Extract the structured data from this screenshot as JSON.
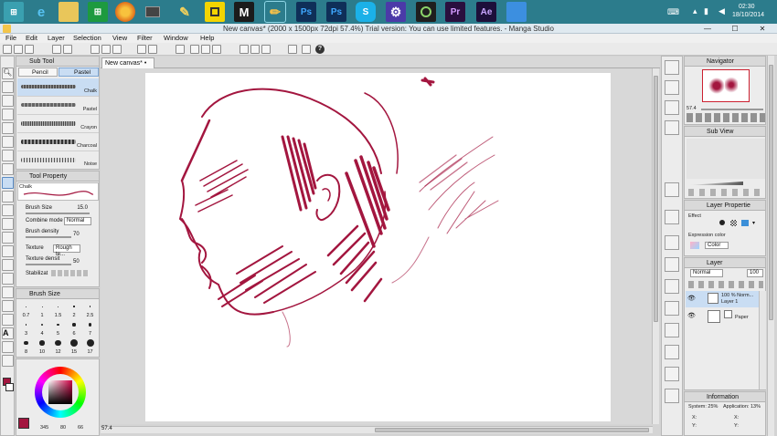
{
  "taskbar": {
    "icons": [
      "windows-store",
      "internet-explorer",
      "file-explorer",
      "store-bag",
      "firefox",
      "tablet",
      "pencil-app",
      "sketch-app",
      "manga-studio",
      "brush",
      "photoshop",
      "photoshop-2",
      "skype",
      "gear",
      "media",
      "premiere",
      "after-effects",
      "blank-app"
    ],
    "icon_labels": [
      "Pr",
      "Ae",
      "Ps",
      "Ps",
      "S",
      "M"
    ],
    "clock_time": "02:30",
    "clock_date": "18/10/2014"
  },
  "window": {
    "title": "New canvas* (2000 x 1500px 72dpi 57.4%)  Trial version: You can use limited features. - Manga Studio",
    "minimize": "—",
    "maximize": "☐",
    "close": "✕"
  },
  "menu": [
    "File",
    "Edit",
    "Layer",
    "Selection",
    "View",
    "Filter",
    "Window",
    "Help"
  ],
  "left_panel": {
    "sub_tool_title": "Sub Tool",
    "tabs": [
      "Pencil",
      "Pastel"
    ],
    "brushes": [
      "Chalk",
      "Pastel",
      "Crayon",
      "Charcoal",
      "Noise"
    ],
    "tool_property_title": "Tool Property",
    "tool_name": "Chalk",
    "props": {
      "brush_size_label": "Brush Size",
      "brush_size_value": "15.0",
      "combine_mode_label": "Combine mode",
      "combine_mode_value": "Normal",
      "brush_density_label": "Brush density",
      "brush_density_value": "70",
      "texture_label": "Texture",
      "texture_value": "Rough te...",
      "texture_density_label": "Texture densit",
      "texture_density_value": "50",
      "stabilization_label": "Stabilizat"
    },
    "brush_size_title": "Brush Size",
    "brush_size_presets": [
      "0.7",
      "1",
      "1.5",
      "2",
      "2.5",
      "3",
      "4",
      "5",
      "6",
      "7",
      "8",
      "10",
      "12",
      "15",
      "17"
    ],
    "color_values": [
      "345",
      "80",
      "66"
    ]
  },
  "canvas": {
    "tab_label": "New canvas*",
    "zoom_readout": "57.4"
  },
  "right_panel": {
    "navigator_title": "Navigator",
    "navigator_zoom": "57.4",
    "sub_view_title": "Sub View",
    "layer_property_title": "Layer Propertie",
    "effect_label": "Effect",
    "expression_color_label": "Expression color",
    "expression_color_value": "Color",
    "layer_title": "Layer",
    "blend_mode": "Normal",
    "opacity": "100",
    "layers": [
      {
        "name": "100 % Norm...",
        "sub": "Layer 1"
      },
      {
        "name": "Paper",
        "sub": ""
      }
    ],
    "info_title": "Information",
    "info_system": "System: 25%",
    "info_app": "Application: 13%",
    "info_x": "X:",
    "info_y": "Y:"
  },
  "colors": {
    "taskbar": "#2c7c8c",
    "ink": "#a3163f",
    "panel": "#ececec",
    "select": "#c9ddf3"
  }
}
